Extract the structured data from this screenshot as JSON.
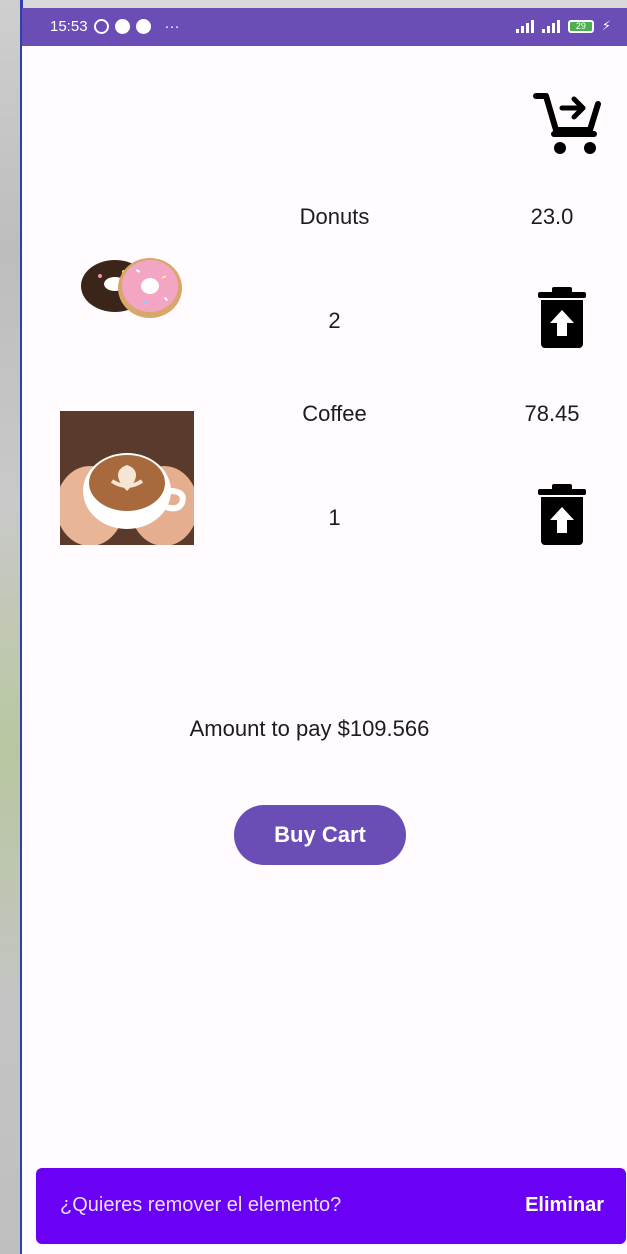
{
  "status_bar": {
    "time": "15:53",
    "more": "···",
    "battery_level": "29"
  },
  "cart": {
    "checkout_icon": "cart-arrow-right-icon",
    "items": [
      {
        "name": "Donuts",
        "price": "23.0",
        "quantity": "2",
        "image": "donuts-photo"
      },
      {
        "name": "Coffee",
        "price": "78.45",
        "quantity": "1",
        "image": "coffee-photo"
      }
    ],
    "amount_text": "Amount to pay $109.566",
    "buy_label": "Buy Cart"
  },
  "snackbar": {
    "message": "¿Quieres remover el elemento?",
    "action": "Eliminar"
  },
  "colors": {
    "primary": "#6a4db5",
    "snackbar": "#6a00f4",
    "background": "#fffbfe"
  }
}
